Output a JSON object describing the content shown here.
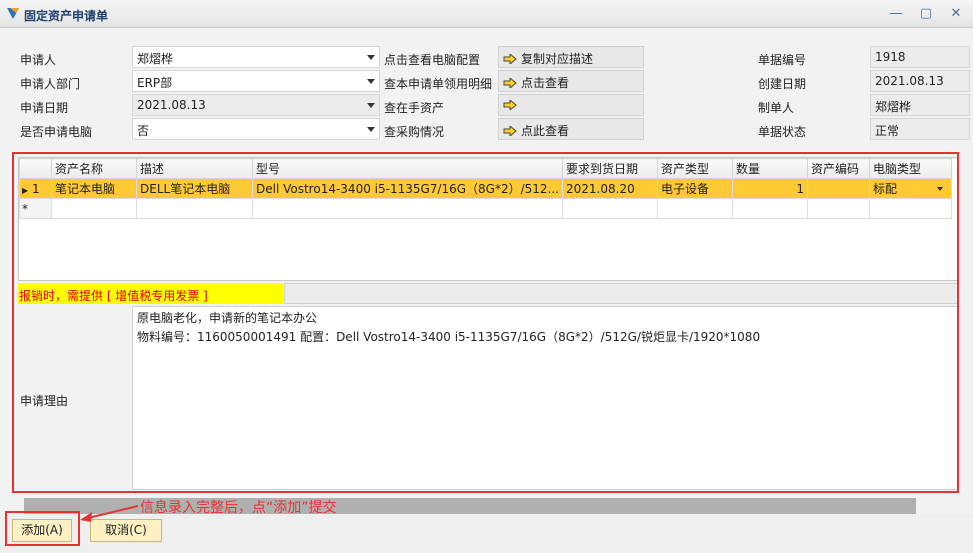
{
  "window": {
    "title": "固定资产申请单",
    "min_symbol": "—",
    "max_symbol": "▢",
    "close_symbol": "✕"
  },
  "form": {
    "applicant_label": "申请人",
    "applicant_value": "郑熠桦",
    "dept_label": "申请人部门",
    "dept_value": "ERP部",
    "date_label": "申请日期",
    "date_value": "2021.08.13",
    "computer_label": "是否申请电脑",
    "computer_value": "否",
    "view_config_label": "点击查看电脑配置",
    "view_config_button": "复制对应描述",
    "view_details_label": "查本申请单领用明细",
    "view_details_button": "点击查看",
    "assets_label": "查在手资产",
    "assets_button": "",
    "purchase_label": "查采购情况",
    "purchase_button": "点此查看",
    "doc_no_label": "单据编号",
    "doc_no_value": "1918",
    "created_label": "创建日期",
    "created_value": "2021.08.13",
    "maker_label": "制单人",
    "maker_value": "郑熠桦",
    "status_label": "单据状态",
    "status_value": "正常"
  },
  "grid": {
    "columns": [
      "资产名称",
      "描述",
      "型号",
      "要求到货日期",
      "资产类型",
      "数量",
      "资产编码",
      "电脑类型"
    ],
    "row": {
      "index": "1",
      "asset_name": "笔记本电脑",
      "description": "DELL笔记本电脑",
      "model": "Dell Vostro14-3400    i5-1135G7/16G（8G*2）/512...",
      "due_date": "2021.08.20",
      "asset_type": "电子设备",
      "quantity": "1",
      "asset_code": "",
      "pc_type": "标配"
    },
    "new_row_marker": "*"
  },
  "notice": "报销时，需提供 [ 增值税专用发票 ]",
  "reason": {
    "label": "申请理由",
    "line1": "原电脑老化，申请新的笔记本办公",
    "line2": "物料编号：1160050001491   配置：Dell Vostro14-3400    i5-1135G7/16G（8G*2）/512G/锐炬显卡/1920*1080"
  },
  "buttons": {
    "add": "添加(A)",
    "cancel": "取消(C)"
  },
  "annotation": {
    "text": "信息录入完整后，点“添加”提交"
  },
  "colors": {
    "highlight_row": "#ffc934",
    "annotation_red": "#e53333",
    "notice_yellow": "#ffff00",
    "button_fill": "#fdf0c2"
  }
}
